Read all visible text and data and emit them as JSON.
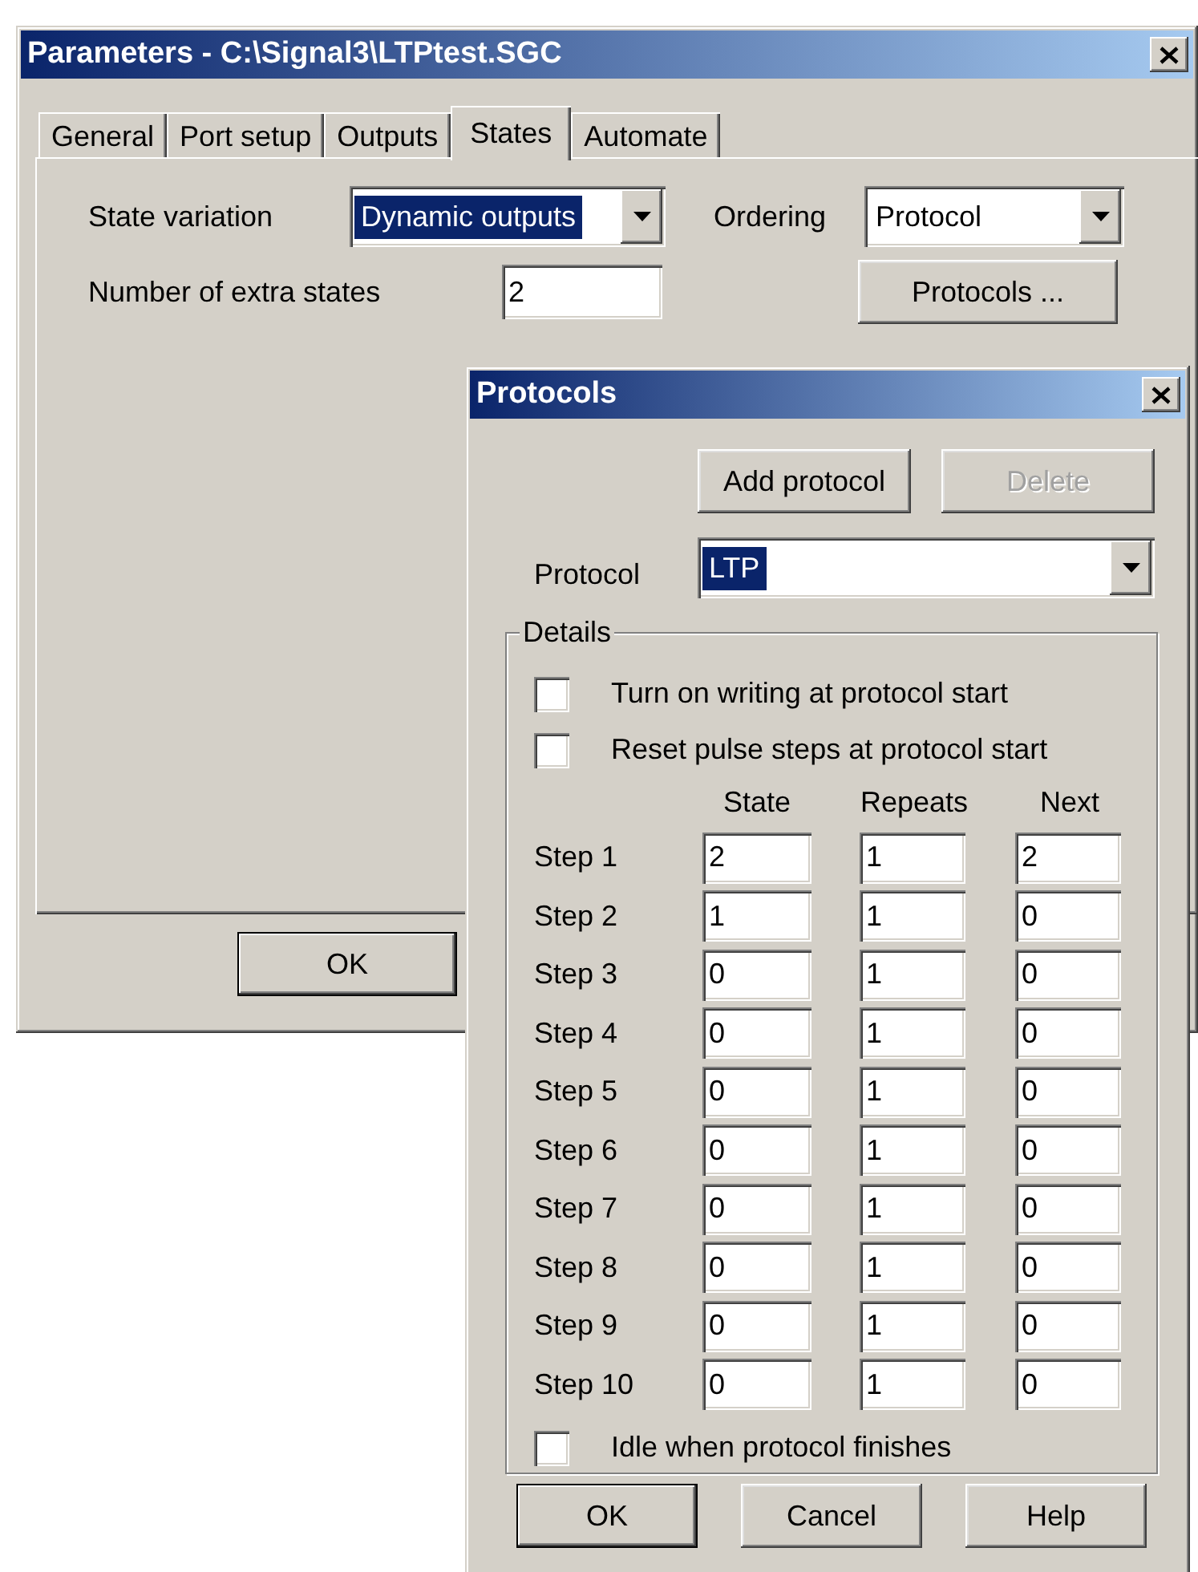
{
  "main_window": {
    "title": "Parameters - C:\\Signal3\\LTPtest.SGC",
    "tabs": [
      {
        "label": "General",
        "selected": false
      },
      {
        "label": "Port setup",
        "selected": false
      },
      {
        "label": "Outputs",
        "selected": false
      },
      {
        "label": "States",
        "selected": true
      },
      {
        "label": "Automate",
        "selected": false
      }
    ],
    "state_variation": {
      "label": "State variation",
      "value": "Dynamic outputs",
      "text_selected": true
    },
    "ordering": {
      "label": "Ordering",
      "value": "Protocol",
      "text_selected": false
    },
    "extra_states": {
      "label": "Number of extra states",
      "value": "2"
    },
    "protocols_button": "Protocols ...",
    "buttons": [
      {
        "label": "OK",
        "default": true
      }
    ]
  },
  "protocols_window": {
    "title": "Protocols",
    "top_buttons": [
      {
        "label": "Add protocol",
        "disabled": false
      },
      {
        "label": "Delete",
        "disabled": true
      }
    ],
    "protocol": {
      "label": "Protocol",
      "value": "LTP",
      "text_selected": true
    },
    "details": {
      "legend": "Details",
      "options": [
        {
          "label": "Turn on writing at protocol start",
          "checked": false
        },
        {
          "label": "Reset pulse steps at protocol start",
          "checked": false
        }
      ],
      "columns": [
        "State",
        "Repeats",
        "Next"
      ],
      "steps": [
        {
          "label": "Step 1",
          "values": [
            "2",
            "1",
            "2"
          ]
        },
        {
          "label": "Step 2",
          "values": [
            "1",
            "1",
            "0"
          ]
        },
        {
          "label": "Step 3",
          "values": [
            "0",
            "1",
            "0"
          ]
        },
        {
          "label": "Step 4",
          "values": [
            "0",
            "1",
            "0"
          ]
        },
        {
          "label": "Step 5",
          "values": [
            "0",
            "1",
            "0"
          ]
        },
        {
          "label": "Step 6",
          "values": [
            "0",
            "1",
            "0"
          ]
        },
        {
          "label": "Step 7",
          "values": [
            "0",
            "1",
            "0"
          ]
        },
        {
          "label": "Step 8",
          "values": [
            "0",
            "1",
            "0"
          ]
        },
        {
          "label": "Step 9",
          "values": [
            "0",
            "1",
            "0"
          ]
        },
        {
          "label": "Step 10",
          "values": [
            "0",
            "1",
            "0"
          ]
        }
      ],
      "idle": {
        "label": "Idle when protocol finishes",
        "checked": false
      }
    },
    "buttons": [
      {
        "label": "OK",
        "default": true
      },
      {
        "label": "Cancel",
        "default": false
      },
      {
        "label": "Help",
        "default": false
      }
    ]
  }
}
